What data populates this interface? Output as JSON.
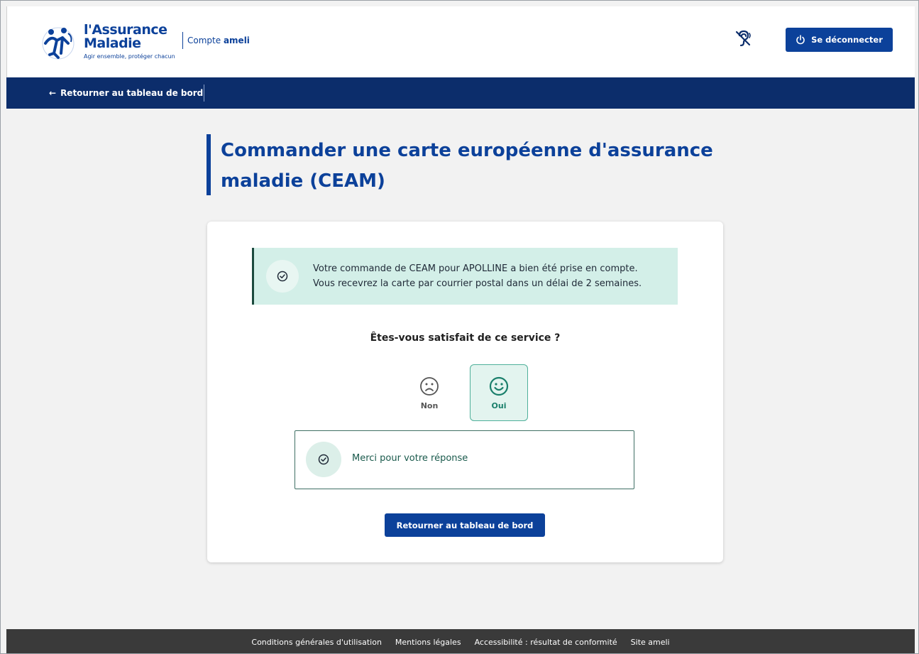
{
  "header": {
    "logo": {
      "line1": "l'Assurance",
      "line2": "Maladie",
      "tagline": "Agir ensemble, protéger chacun"
    },
    "account": {
      "prefix": "Compte",
      "name": "ameli"
    },
    "logout_label": "Se déconnecter",
    "icons": {
      "accessibility": "hearing-disabled-icon",
      "logout": "power-icon"
    }
  },
  "nav": {
    "back_label": "Retourner au tableau de bord",
    "back_arrow": "←"
  },
  "page": {
    "title": "Commander une carte européenne d'assurance maladie (CEAM)"
  },
  "card": {
    "alert": {
      "line1": "Votre commande de CEAM pour APOLLINE a bien été prise en compte.",
      "line2": "Vous recevrez la carte par courrier postal dans un délai de 2 semaines."
    },
    "survey": {
      "question": "Êtes-vous satisfait de ce service ?",
      "options": [
        {
          "label": "Non",
          "icon": "sad-face-icon",
          "selected": false
        },
        {
          "label": "Oui",
          "icon": "happy-face-icon",
          "selected": true
        }
      ]
    },
    "thanks": "Merci pour votre réponse",
    "return_label": "Retourner au tableau de bord"
  },
  "footer": {
    "links": [
      "Conditions générales d'utilisation",
      "Mentions légales",
      "Accessibilité : résultat de conformité",
      "Site ameli"
    ]
  },
  "colors": {
    "primary_blue": "#0c419a",
    "nav_dark_blue": "#0c2d6b",
    "success_bg": "#d3efe8",
    "success_accent": "#1a7f6b",
    "footer_bg": "#3a3a3a",
    "page_bg": "#f2f2f2"
  }
}
